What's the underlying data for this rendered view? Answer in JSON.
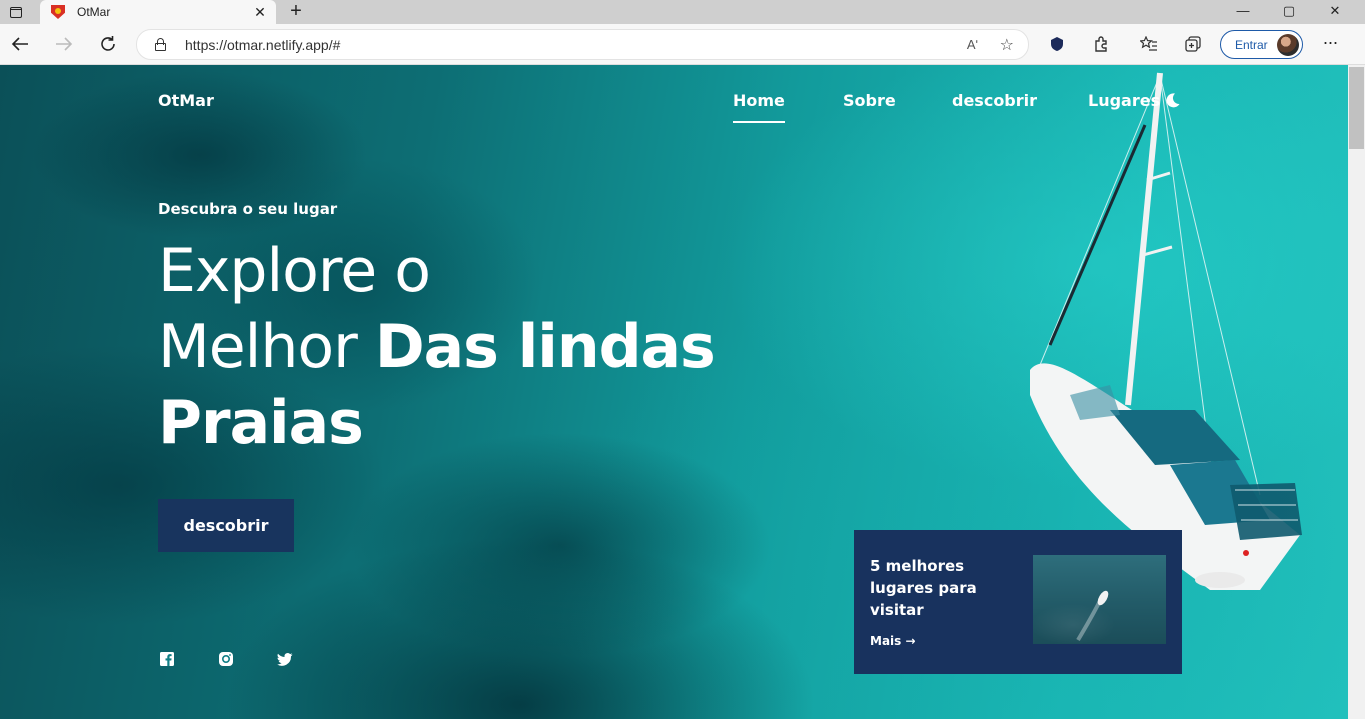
{
  "browser": {
    "tab_title": "OtMar",
    "tab_close": "✕",
    "new_tab": "+",
    "url": "https://otmar.netlify.app/#",
    "read_aloud": "Aʹ",
    "sign_in_label": "Entrar",
    "more_menu": "···",
    "window_controls": [
      "—",
      "▢",
      "✕"
    ]
  },
  "site": {
    "logo": "OtMar",
    "nav": [
      {
        "label": "Home",
        "active": true
      },
      {
        "label": "Sobre",
        "active": false
      },
      {
        "label": "descobrir",
        "active": false
      },
      {
        "label": "Lugares",
        "active": false
      }
    ],
    "theme_toggle_icon": "moon-icon"
  },
  "hero": {
    "subtitle": "Descubra o seu lugar",
    "headline_line1": "Explore o",
    "headline_line2_regular": "Melhor ",
    "headline_line2_bold": "Das lindas",
    "headline_line3_bold": "Praias",
    "cta_label": "descobrir",
    "social_icons": [
      "facebook-icon",
      "instagram-icon",
      "twitter-icon"
    ]
  },
  "card": {
    "title": "5 melhores lugares para visitar",
    "link_label": "Mais",
    "link_arrow": "→"
  },
  "colors": {
    "cta_bg": "#18345e",
    "card_bg": "#18325e",
    "sea": "#1bb9b6",
    "signin_accent": "#1e5aa8"
  }
}
